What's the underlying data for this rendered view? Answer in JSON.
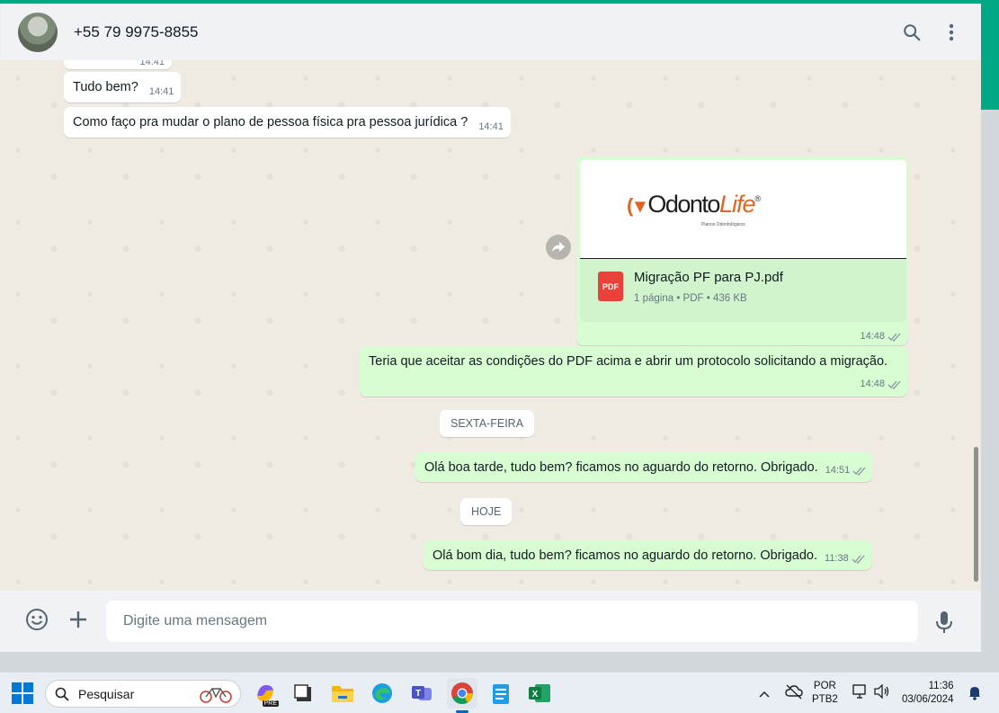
{
  "header": {
    "contact_name": "+55 79 9975-8855",
    "icons": [
      "search-icon",
      "menu-dots-icon"
    ]
  },
  "messages": {
    "partial_time": "14:41",
    "in1_text": "Tudo bem?",
    "in1_time": "14:41",
    "in2_text": "Como faço pra mudar o plano de pessoa física pra pessoa jurídica ?",
    "in2_time": "14:41",
    "pdf": {
      "logo_main": "Odonto",
      "logo_accent": "Life",
      "logo_reg": "®",
      "logo_tagline": "Planos Odontológicos",
      "badge": "PDF",
      "filename": "Migração PF para PJ.pdf",
      "meta": "1 página • PDF • 436 KB",
      "time": "14:48"
    },
    "out1_text": "Teria que aceitar as condições do PDF acima e abrir um protocolo solicitando a migração.",
    "out1_time": "14:48",
    "day1": "SEXTA-FEIRA",
    "out2_text": "Olá boa tarde, tudo bem? ficamos no aguardo do retorno. Obrigado.",
    "out2_time": "14:51",
    "day2": "HOJE",
    "out3_text": "Olá bom dia, tudo bem? ficamos no aguardo do retorno. Obrigado.",
    "out3_time": "11:38"
  },
  "composer": {
    "placeholder": "Digite uma mensagem",
    "icons": [
      "emoji-icon",
      "plus-icon",
      "microphone-icon"
    ]
  },
  "taskbar": {
    "search_label": "Pesquisar",
    "copilot_badge": "PRE",
    "language_line1": "POR",
    "language_line2": "PTB2",
    "clock_time": "11:36",
    "clock_date": "03/06/2024"
  },
  "colors": {
    "accent": "#00a884",
    "outgoing_bubble": "#d9fdd3",
    "incoming_bubble": "#ffffff",
    "chat_background": "#efeae2",
    "read_check": "#8696a0"
  }
}
